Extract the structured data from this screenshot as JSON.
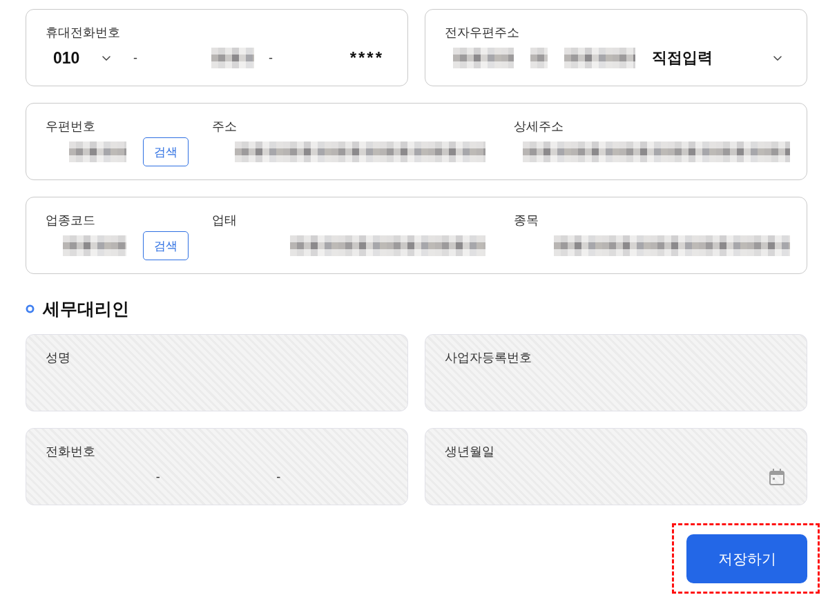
{
  "contact": [
    {
      "kind": "phone",
      "label": "휴대전화번호",
      "prefix": "010",
      "separators": [
        "-",
        "-"
      ],
      "middle": {
        "redacted": true
      },
      "last": "****"
    },
    {
      "kind": "email",
      "label": "전자우편주소",
      "parts": [
        {
          "redacted": true
        },
        {
          "redacted": true
        },
        {
          "redacted": true
        }
      ],
      "domain_select": "직접입력"
    }
  ],
  "field_rows": [
    {
      "fields": [
        {
          "label": "우편번호",
          "value": {
            "redacted": true
          },
          "button": "검색"
        },
        {
          "label": "주소",
          "value": {
            "redacted": true
          }
        },
        {
          "label": "상세주소",
          "value": {
            "redacted": true
          }
        }
      ]
    },
    {
      "fields": [
        {
          "label": "업종코드",
          "value": {
            "redacted": true
          },
          "button": "검색"
        },
        {
          "label": "업태",
          "value": {
            "redacted": true
          }
        },
        {
          "label": "종목",
          "value": {
            "redacted": true
          }
        }
      ]
    }
  ],
  "tax_agent": {
    "title": "세무대리인",
    "fields": [
      {
        "kind": "text",
        "label": "성명",
        "disabled": true
      },
      {
        "kind": "text",
        "label": "사업자등록번호",
        "disabled": true
      },
      {
        "kind": "phone",
        "label": "전화번호",
        "separators": [
          "-",
          "-"
        ],
        "disabled": true
      },
      {
        "kind": "date",
        "label": "생년월일",
        "disabled": true
      }
    ]
  },
  "save_button": {
    "label": "저장하기",
    "highlighted": true
  }
}
